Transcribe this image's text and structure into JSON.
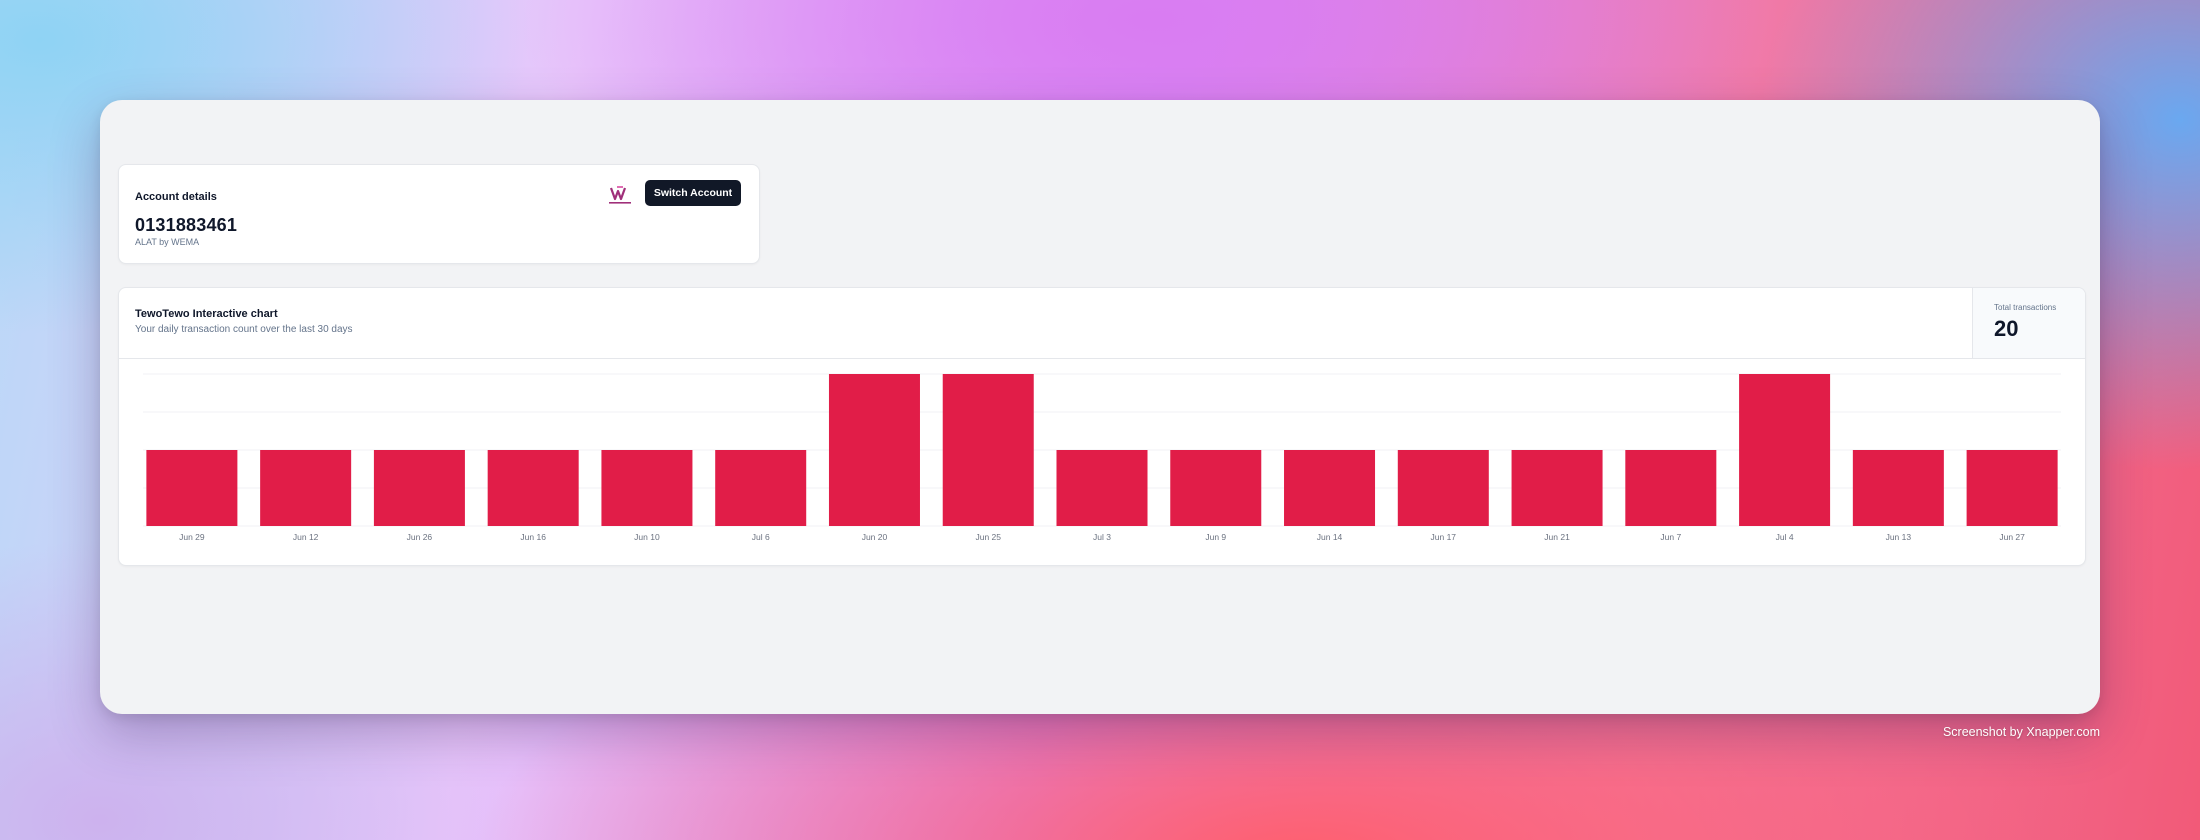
{
  "account": {
    "section_title": "Account details",
    "number": "0131883461",
    "bank_label": "ALAT by WEMA",
    "logo_icon": "wema-bank-logo-icon",
    "switch_button": "Switch Account"
  },
  "chart_card": {
    "title": "TewoTewo Interactive chart",
    "subtitle": "Your daily transaction count over the last 30 days",
    "total_label": "Total transactions",
    "total_value": "20"
  },
  "colors": {
    "bar": "#e11d48",
    "button": "#111827",
    "window_bg": "#f2f3f5"
  },
  "chart_data": {
    "type": "bar",
    "title": "TewoTewo Interactive chart",
    "categories": [
      "Jun 29",
      "Jun 12",
      "Jun 26",
      "Jun 16",
      "Jun 10",
      "Jul 6",
      "Jun 20",
      "Jun 25",
      "Jul 3",
      "Jun 9",
      "Jun 14",
      "Jun 17",
      "Jun 21",
      "Jun 7",
      "Jul 4",
      "Jun 13",
      "Jun 27"
    ],
    "values": [
      1,
      1,
      1,
      1,
      1,
      1,
      2,
      2,
      1,
      1,
      1,
      1,
      1,
      1,
      2,
      1,
      1
    ],
    "ylim": [
      0,
      2
    ],
    "xlabel": "",
    "ylabel": "",
    "grid": true,
    "legend": "none"
  },
  "watermark": "Screenshot by Xnapper.com"
}
